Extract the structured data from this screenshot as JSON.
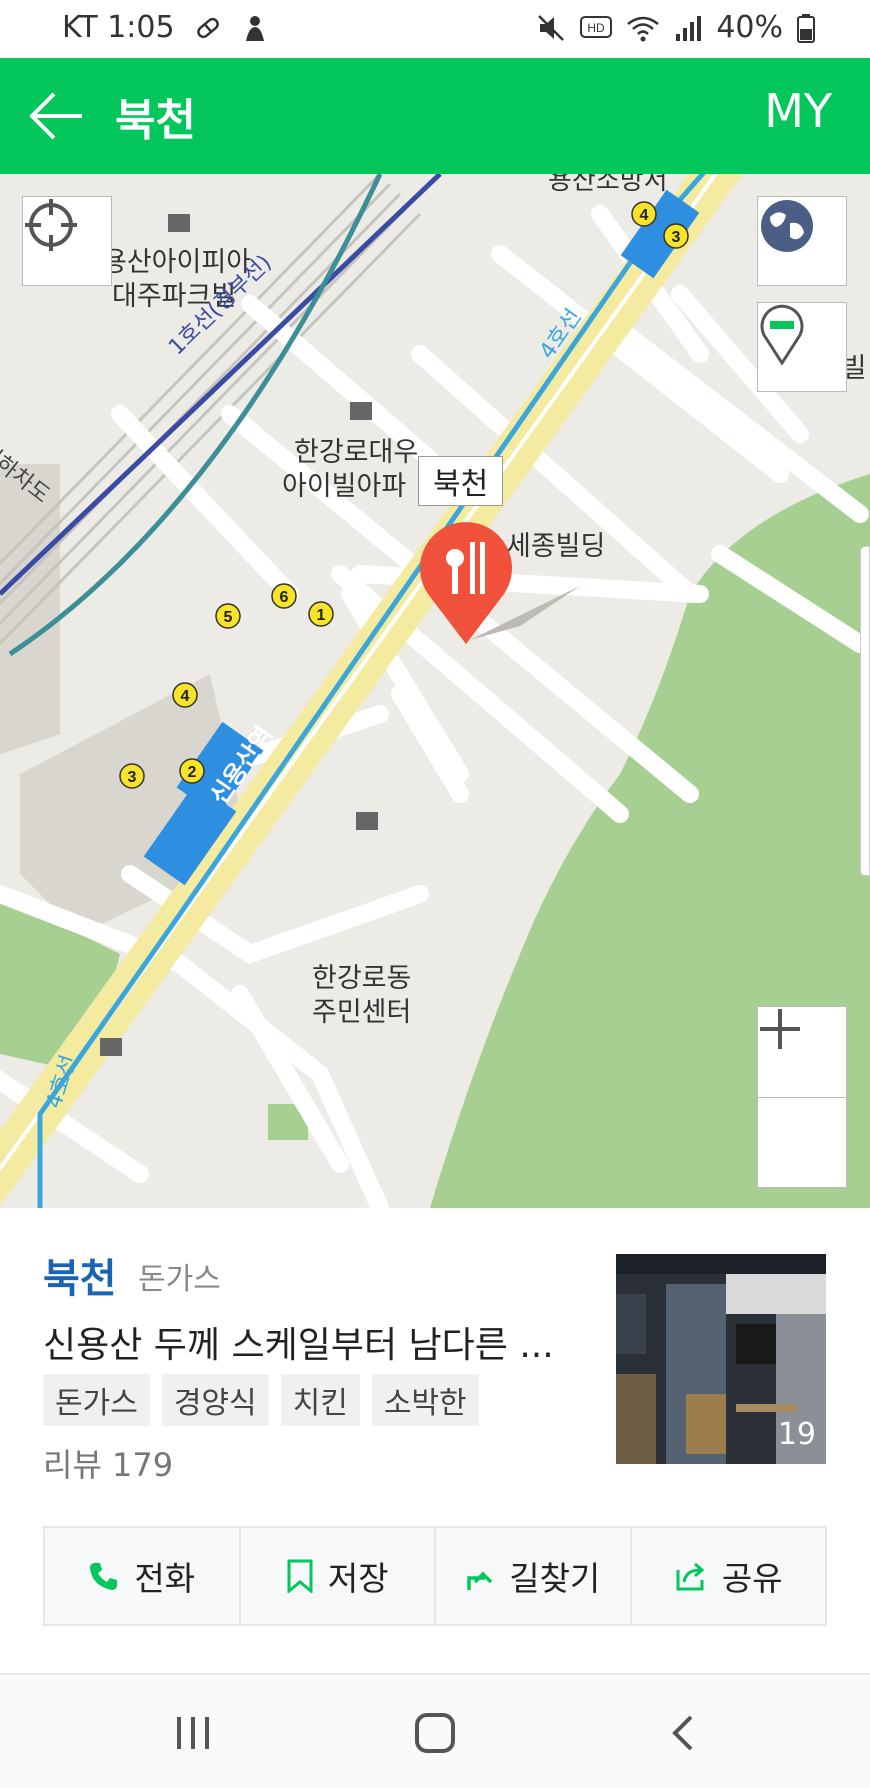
{
  "status_bar": {
    "carrier_time": "KT 1:05",
    "battery": "40%"
  },
  "header": {
    "title": "북천",
    "my_label": "MY"
  },
  "map": {
    "labels": {
      "building1": "용산아이피아",
      "building1b": "대주파크빌",
      "line1": "1호선(경부선)",
      "line4_top": "4호선",
      "line4_bottom": "4호선",
      "hangang_apt": "한강로대우",
      "hangang_apt_b": "아이빌아파",
      "sejong": "세종빌딩",
      "shinwoo": "신우빌",
      "community_center": "한강로동",
      "community_center_b": "주민센터",
      "station": "신용산역",
      "underpass": "지하차도",
      "top_cut": "용산소방서"
    },
    "marker_label": "북천",
    "exits": [
      "4",
      "3",
      "6",
      "5",
      "1",
      "4",
      "3",
      "2"
    ]
  },
  "place": {
    "name": "북천",
    "category": "돈가스",
    "description": "신용산 두께 스케일부터 남다른 ...",
    "tags": [
      "돈가스",
      "경양식",
      "치킨",
      "소박한"
    ],
    "review": "리뷰 179",
    "photo_count": "19"
  },
  "actions": {
    "call": "전화",
    "save": "저장",
    "directions": "길찾기",
    "share": "공유"
  },
  "colors": {
    "brand_green": "#03c75a",
    "name_blue": "#1a64b4",
    "marker_red": "#f0513a"
  }
}
